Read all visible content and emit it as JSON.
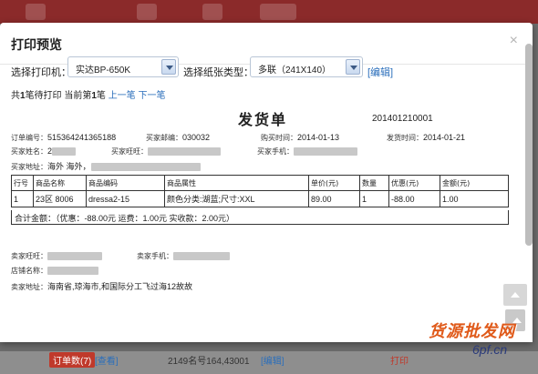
{
  "modal": {
    "title": "打印预览",
    "close": "×"
  },
  "toolbar": {
    "printer_label": "选择打印机：",
    "printer_value": "实达BP-650K",
    "paper_label": "选择纸张类型：",
    "paper_value": "多联（241X140）",
    "edit_link": "[编辑]"
  },
  "status": {
    "total_prefix": "共",
    "total_count": "1",
    "total_mid": "笔待打印 当前第",
    "current": "1",
    "current_suffix": "笔",
    "prev": "上一笔",
    "next": "下一笔"
  },
  "invoice": {
    "title": "发货单",
    "number": "201401210001",
    "order_no_label": "订单编号：",
    "order_no": "515364241365188",
    "buyer_email_label": "买家邮编：",
    "buyer_email": "030032",
    "purchase_time_label": "购买时间：",
    "purchase_time": "2014-01-13",
    "ship_time_label": "发货时间：",
    "ship_time": "2014-01-21",
    "buyer_name_label": "买家姓名：",
    "buyer_name": "2",
    "buyer_wangwang_label": "买家旺旺：",
    "buyer_phone_label": "买家手机：",
    "buyer_addr_label": "买家地址：",
    "buyer_addr": "海外 海外，",
    "table_headers": [
      "行号",
      "商品名称",
      "商品编码",
      "商品属性",
      "单价(元)",
      "数量",
      "优惠(元)",
      "金额(元)"
    ],
    "table_rows": [
      [
        "1",
        "23区 8006",
        "dressa2-15",
        "颜色分类:湖蓝;尺寸:XXL",
        "89.00",
        "1",
        "-88.00",
        "1.00"
      ]
    ],
    "totals_text": "合计金额：（优惠：-88.00元    运费：1.00元    实收款：2.00元）",
    "seller_wangwang_label": "卖家旺旺：",
    "seller_phone_label": "卖家手机：",
    "shop_name_label": "店铺名称：",
    "seller_addr_label": "卖家地址：",
    "seller_addr": "海南省,琼海市,和国际分工飞过海12故故"
  },
  "background": {
    "badge": "订单数(7)",
    "badge_link": "[查看]",
    "row_text": "2149名号164,43001",
    "edit": "[编辑]",
    "print_text": "打印"
  },
  "watermark": {
    "line1": "货源批发网",
    "line2": "6pf.cn"
  },
  "colors": {
    "brand": "#8b2a2a",
    "link": "#2a6ebb",
    "watermark": "#e05a1a"
  }
}
